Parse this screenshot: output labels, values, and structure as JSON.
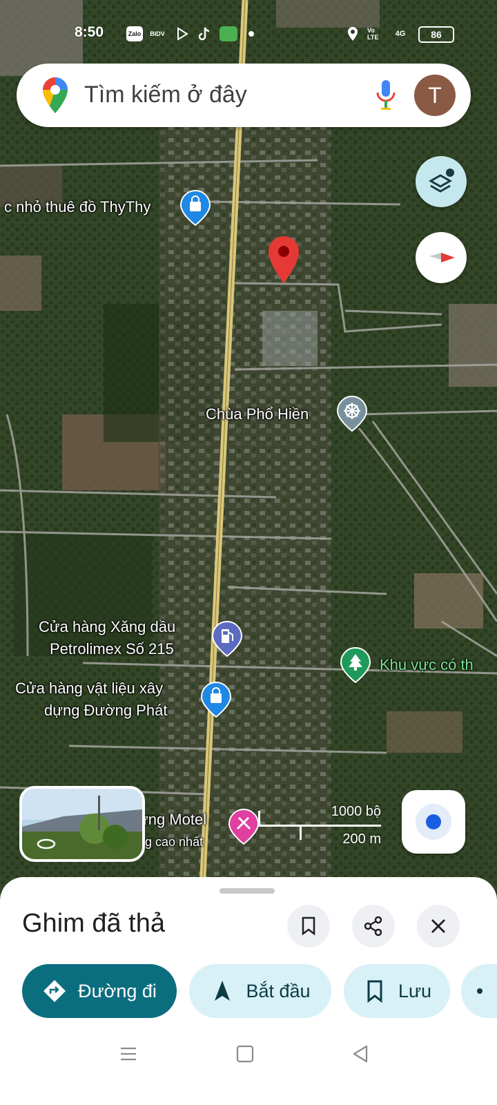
{
  "status_bar": {
    "time": "8:50",
    "app_icons": [
      "zalo-icon",
      "bidv-icon",
      "play-icon",
      "tiktok-icon",
      "messages-icon"
    ],
    "zalo_text": "Zalo",
    "bidv_text": "BIDV",
    "volte_text": "Vo LTE",
    "network_text": "4G",
    "battery": "86"
  },
  "search": {
    "placeholder": "Tìm kiếm ở đây",
    "avatar_letter": "T"
  },
  "map": {
    "labels": {
      "thythy": "c nhỏ thuê đồ ThyThy",
      "pagoda": "Chùa Phổ Hiền",
      "petrol_line1": "Cửa hàng Xăng dầu",
      "petrol_line2": "Petrolimex Số 215",
      "forest": "Khu vực có th",
      "material_line1": "Cửa hàng vật liệu xây",
      "material_line2": "dựng Đường Phát",
      "motel_line1": "ưng Motel",
      "motel_line2": "ng cao nhất"
    },
    "scale": {
      "imperial": "1000 bộ",
      "metric": "200 m"
    }
  },
  "sheet": {
    "title": "Ghim đã thả",
    "chips": {
      "directions": "Đường đi",
      "start": "Bắt đầu",
      "save": "Lưu"
    }
  },
  "colors": {
    "teal_primary": "#0b6e7f",
    "chip_light": "#d8f1f6",
    "pin_red": "#e53935",
    "poi_blue": "#1e88e5",
    "poi_purple": "#5c6bc0",
    "poi_green": "#1e9b5a",
    "poi_pink": "#e040a0",
    "road_yellow": "#d9c77a"
  }
}
